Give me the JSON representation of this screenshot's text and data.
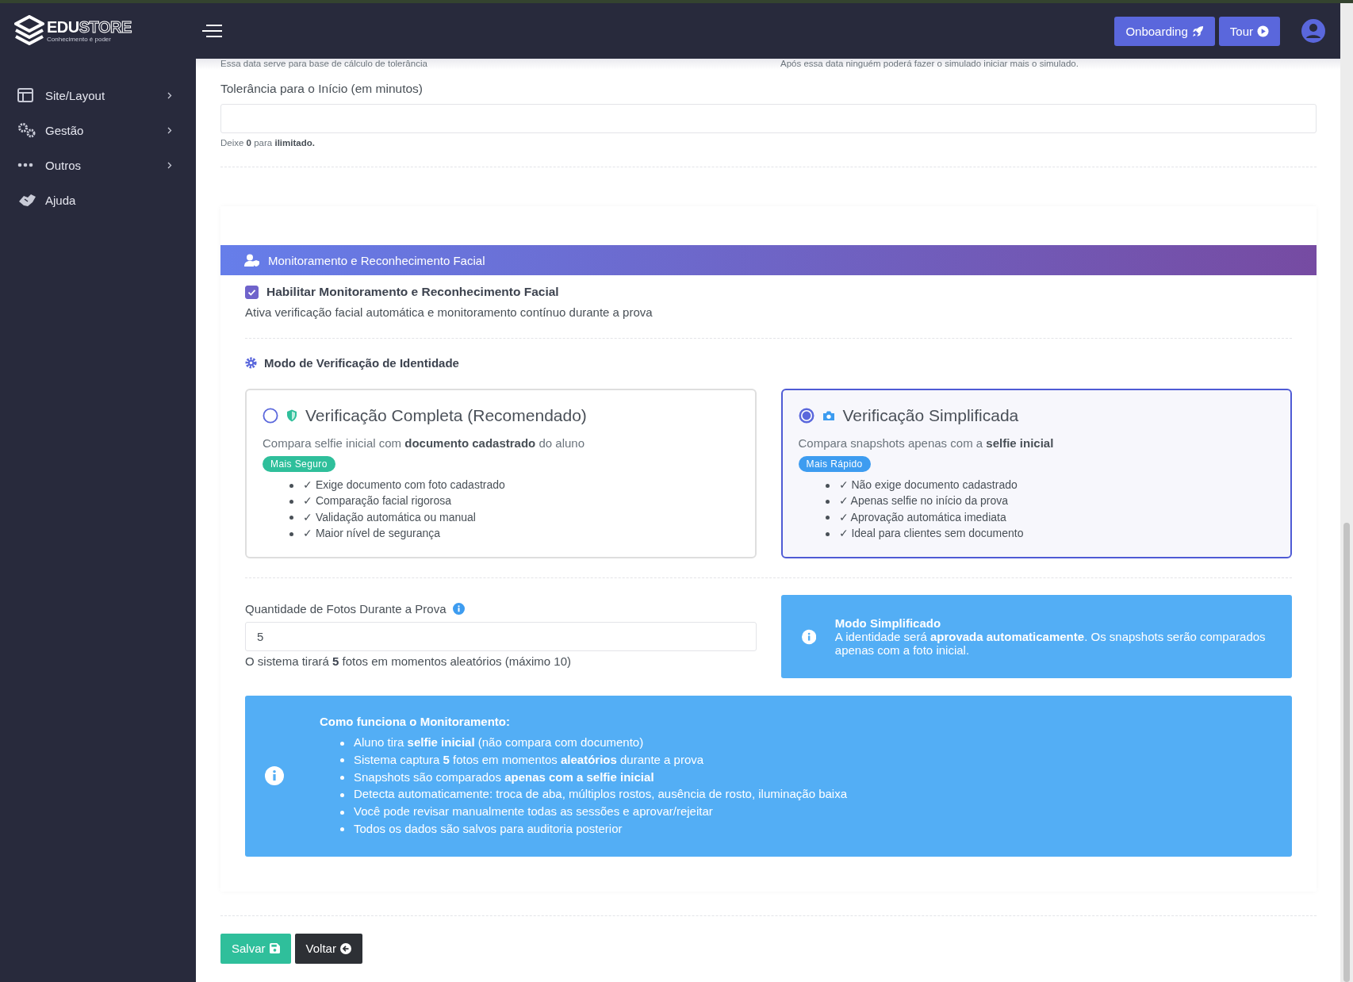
{
  "logo": {
    "title": "EDU",
    "title_accent": "STORE",
    "tagline": "Conhecimento é poder"
  },
  "sidebar": {
    "items": [
      {
        "label": "Site/Layout",
        "has_submenu": true
      },
      {
        "label": "Gestão",
        "has_submenu": true
      },
      {
        "label": "Outros",
        "has_submenu": true
      },
      {
        "label": "Ajuda",
        "has_submenu": false
      }
    ]
  },
  "header": {
    "buttons": [
      {
        "label": "Onboarding"
      },
      {
        "label": "Tour"
      }
    ]
  },
  "top_fields": {
    "left_help": "Essa data serve para base de cálculo de tolerância",
    "right_help": "Após essa data ninguém poderá fazer o simulado iniciar mais o simulado.",
    "tolerance": {
      "label": "Tolerância para o Início (em minutos)",
      "help": "Deixe **0** para **ilimitado.**"
    }
  },
  "monitoring": {
    "header": "Monitoramento e Reconhecimento Facial",
    "enable": {
      "label": "Habilitar Monitoramento e Reconhecimento Facial",
      "checked": true
    },
    "description": "Ativa verificação facial automática e monitoramento contínuo durante a prova",
    "mode_title": "Modo de Verificação de Identidade",
    "options": [
      {
        "title": "Verificação Completa (Recomendado)",
        "description": "Compara selfie inicial com **documento cadastrado** do aluno",
        "badge": "Mais Seguro",
        "color": "#2fbf9b",
        "selected": false,
        "features": [
          "✓ Exige documento com foto cadastrado",
          "✓ Comparação facial rigorosa",
          "✓ Validação automática ou manual",
          "✓ Maior nível de segurança"
        ]
      },
      {
        "title": "Verificação Simplificada",
        "description": "Compara snapshots apenas com a **selfie inicial**",
        "badge": "Mais Rápido",
        "color": "#3d9cf0",
        "selected": true,
        "features": [
          "✓ Não exige documento cadastrado",
          "✓ Apenas selfie no início da prova",
          "✓ Aprovação automática imediata",
          "✓ Ideal para clientes sem documento"
        ]
      }
    ],
    "photos": {
      "label": "Quantidade de Fotos Durante a Prova",
      "value": "5",
      "help": "O sistema tirará **5** fotos em momentos aleatórios (máximo 10)"
    },
    "mode_info": {
      "title": "Modo Simplificado",
      "text": "A identidade será **aprovada automaticamente**. Os snapshots serão comparados apenas com a foto inicial."
    },
    "how_it_works": {
      "title": "Como funciona o Monitoramento:",
      "items": [
        "Aluno tira **selfie inicial** (não compara com documento)",
        "Sistema captura **5** fotos em momentos **aleatórios** durante a prova",
        "Snapshots são comparados **apenas com a selfie inicial**",
        "Detecta automaticamente: troca de aba, múltiplos rostos, ausência de rosto, iluminação baixa",
        "Você pode revisar manualmente todas as sessões e aprovar/rejeitar",
        "Todos os dados são salvos para auditoria posterior"
      ]
    }
  },
  "actions": [
    {
      "label": "Salvar",
      "kind": "save"
    },
    {
      "label": "Voltar",
      "kind": "back"
    }
  ]
}
